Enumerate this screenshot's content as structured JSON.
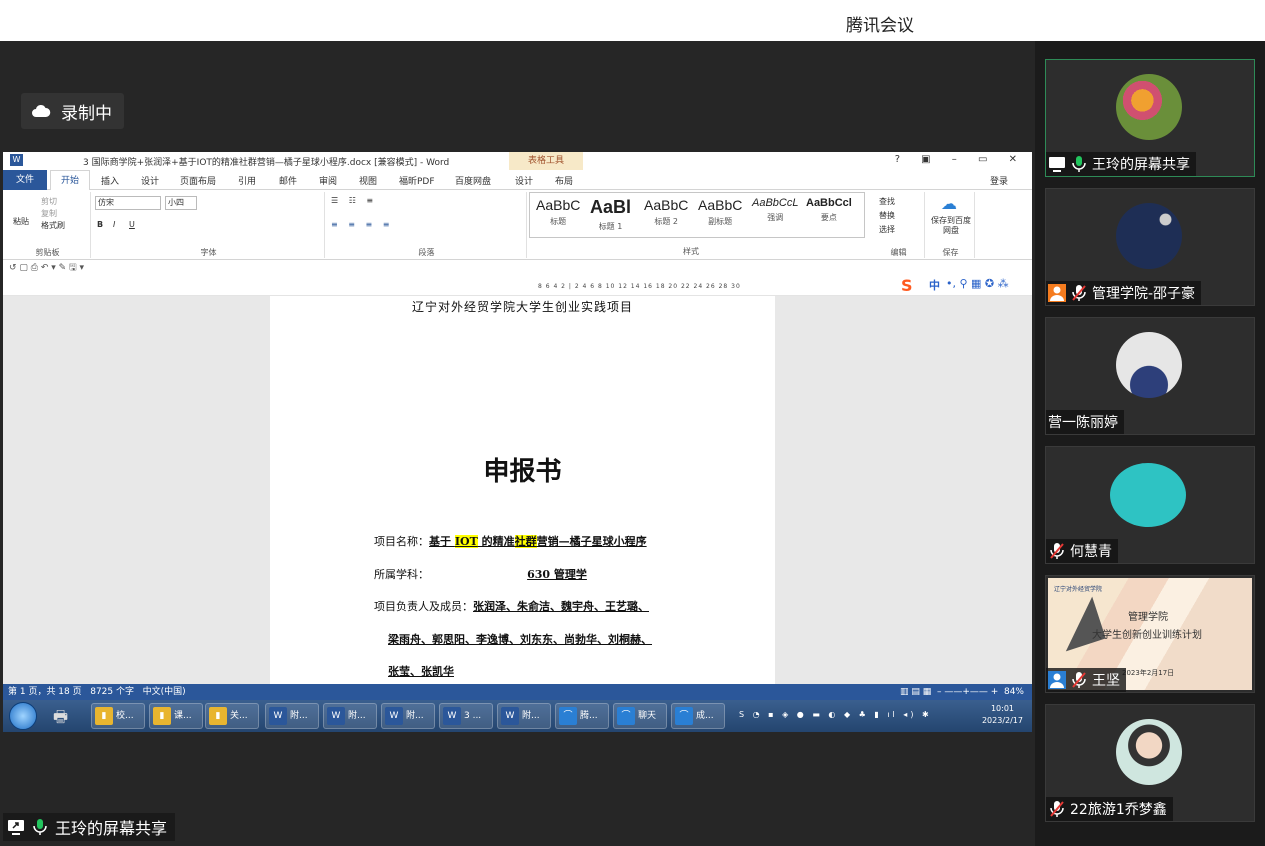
{
  "app": {
    "title": "腾讯会议"
  },
  "recording": {
    "label": "录制中"
  },
  "share": {
    "label": "王玲的屏幕共享"
  },
  "word": {
    "doc_title": "3 国际商学院+张润泽+基于IOT的精准社群营销—橘子星球小程序.docx [兼容模式] - Word",
    "context_tab": "表格工具",
    "window_buttons": "? ▣ – ▭ ✕",
    "tabs": [
      "文件",
      "开始",
      "插入",
      "设计",
      "页面布局",
      "引用",
      "邮件",
      "审阅",
      "视图",
      "福昕PDF",
      "百度网盘",
      "设计",
      "布局"
    ],
    "login": "登录",
    "ribbon": {
      "clipboard": {
        "paste": "粘贴",
        "cut": "剪切",
        "copy": "复制",
        "format_painter": "格式刷",
        "label": "剪贴板"
      },
      "font": {
        "name": "仿宋",
        "size": "小四",
        "label": "字体"
      },
      "paragraph": {
        "label": "段落"
      },
      "styles": {
        "label": "样式",
        "items": [
          {
            "sample": "AaBbC",
            "name": "标题"
          },
          {
            "sample": "AaBl",
            "name": "标题 1"
          },
          {
            "sample": "AaBbC",
            "name": "标题 2"
          },
          {
            "sample": "AaBbC",
            "name": "副标题"
          },
          {
            "sample": "AaBbCcL",
            "name": "强调"
          },
          {
            "sample": "AaBbCcl",
            "name": "要点"
          }
        ]
      },
      "editing": {
        "find": "查找",
        "replace": "替换",
        "select": "选择",
        "label": "编辑"
      },
      "save": {
        "button": "保存到百度网盘",
        "label": "保存"
      }
    },
    "ruler": "8  6  4  2  |  2  4  6  8  10  12  14  16  18  20  22  24  26  28  30",
    "ime": {
      "logo": "S",
      "mode": "中"
    },
    "document": {
      "header": "辽宁对外经贸学院大学生创业实践项目",
      "title": "申报书",
      "fields": [
        {
          "label": "项目名称：",
          "value_pre": "基于 ",
          "hl1": "IOT",
          "value_mid": " 的精准",
          "hl2": "社群",
          "value_post": "营销—橘子星球小程序"
        },
        {
          "label": "所属学科：",
          "value": "630 管理学"
        },
        {
          "label": "项目负责人及成员：",
          "value": "张润泽、朱俞洁、魏宇舟、王艺璐、"
        },
        {
          "label": "",
          "value": "梁雨舟、郭思阳、李逸博、刘东东、尚勃华、刘桐赫、"
        },
        {
          "label": "",
          "value": "张莹、张凯华"
        }
      ]
    },
    "status": {
      "page": "第 1 页，共 18 页",
      "words": "8725 个字",
      "lang": "中文(中国)",
      "zoom": "84%"
    }
  },
  "taskbar": {
    "buttons": [
      {
        "icon": "folder",
        "label": "校..."
      },
      {
        "icon": "folder",
        "label": "课..."
      },
      {
        "icon": "folder",
        "label": "关..."
      },
      {
        "icon": "word",
        "label": "附..."
      },
      {
        "icon": "word",
        "label": "附..."
      },
      {
        "icon": "word",
        "label": "附..."
      },
      {
        "icon": "word",
        "label": "3 ..."
      },
      {
        "icon": "word",
        "label": "附..."
      },
      {
        "icon": "meeting",
        "label": "腾..."
      },
      {
        "icon": "meeting",
        "label": "聊天"
      },
      {
        "icon": "meeting",
        "label": "成..."
      }
    ],
    "clock": {
      "time": "10:01",
      "date": "2023/2/17"
    }
  },
  "participants": [
    {
      "name": "王玲的屏幕共享",
      "avatar": "flower",
      "color": "#6a8f3a"
    },
    {
      "name": "管理学院-邵子豪",
      "avatar": "moon",
      "color": "#1e2e55"
    },
    {
      "name": "营一陈丽婷",
      "avatar": "person",
      "color": "#d8d8d8"
    },
    {
      "name": "何慧青",
      "avatar": "teal-circle",
      "color": "#2ec3c3"
    },
    {
      "name": "王坚",
      "avatar": "slide",
      "slide_logo": "辽宁对外经贸学院",
      "slide_t1": "管理学院",
      "slide_t2": "大学生创新创业训练计划",
      "slide_t3": "2023年2月17日"
    },
    {
      "name": "22旅游1乔梦鑫",
      "avatar": "girl",
      "color": "#cfe6df"
    }
  ]
}
